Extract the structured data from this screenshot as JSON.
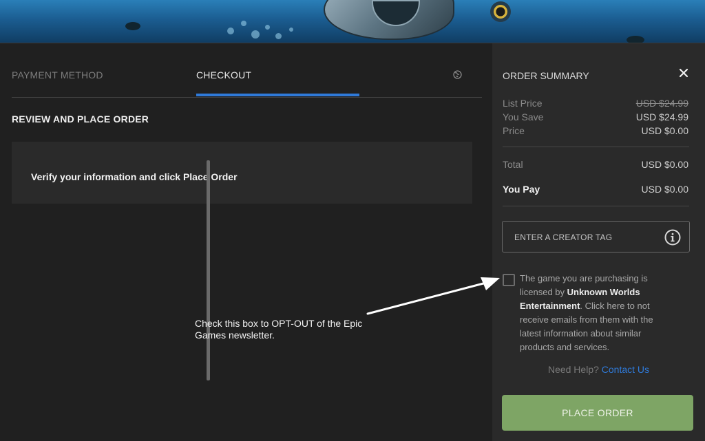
{
  "tabs": [
    {
      "label": "PAYMENT METHOD"
    },
    {
      "label": "CHECKOUT"
    }
  ],
  "main": {
    "section_title": "REVIEW AND PLACE ORDER",
    "info_message": "Verify your information and click Place Order"
  },
  "summary": {
    "title": "ORDER SUMMARY",
    "rows": [
      {
        "label": "List Price",
        "value": "USD $24.99"
      },
      {
        "label": "You Save",
        "value": "USD $24.99"
      },
      {
        "label": "Price",
        "value": "USD $0.00"
      },
      {
        "label": "Total",
        "value": "USD $0.00"
      },
      {
        "label": "You Pay",
        "value": "USD $0.00"
      }
    ],
    "creator_tag_placeholder": "ENTER A CREATOR TAG",
    "license": {
      "prefix": "The game you are purchasing is licensed by ",
      "company": "Unknown Worlds Entertainment",
      "suffix": ". Click here to not receive emails from them with the latest information about similar products and services."
    },
    "help_question": "Need Help?",
    "help_link": "Contact Us",
    "place_order_label": "PLACE ORDER"
  },
  "annotation": {
    "text": "Check this box to OPT-OUT of the Epic Games newsletter."
  },
  "colors": {
    "accent": "#2f7ad9",
    "place_order_bg": "#7ea565",
    "panel_bg": "#2a2a2a",
    "background": "#202020"
  },
  "icons": [
    "globe-icon",
    "close-icon",
    "info-icon",
    "checkbox"
  ]
}
